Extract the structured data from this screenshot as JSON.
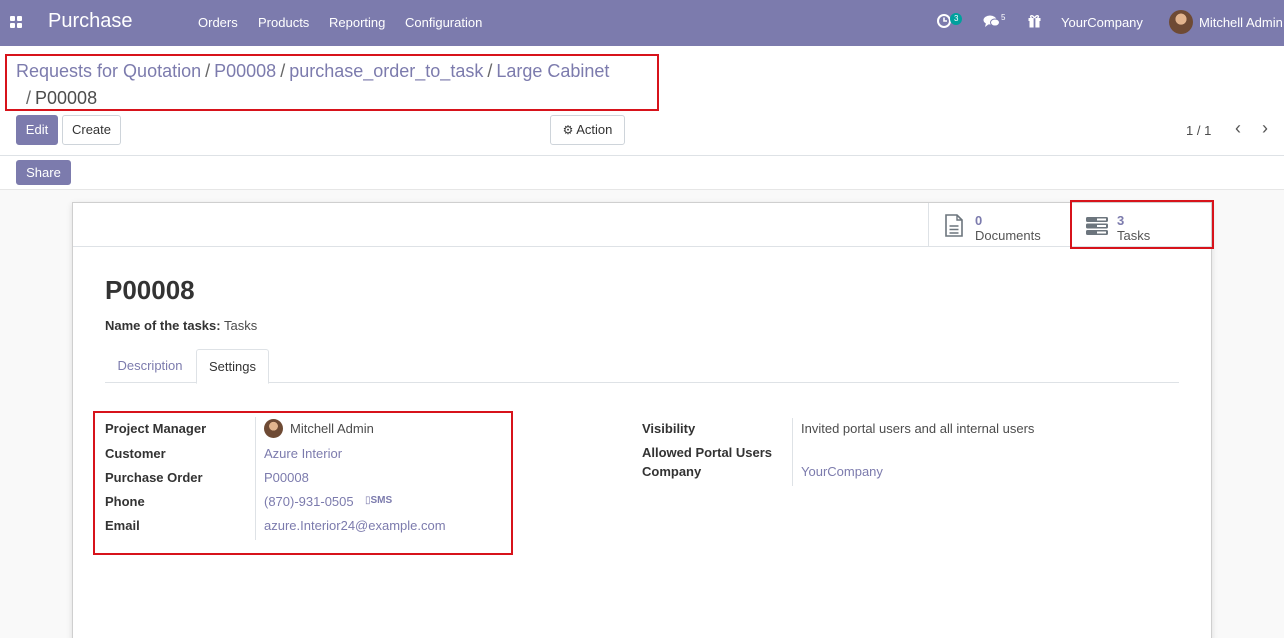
{
  "navbar": {
    "app_title": "Purchase",
    "menu": [
      "Orders",
      "Products",
      "Reporting",
      "Configuration"
    ],
    "activity_count": "3",
    "message_count": "5",
    "company": "YourCompany",
    "user": "Mitchell Admin"
  },
  "breadcrumb": {
    "items": [
      "Requests for Quotation",
      "P00008",
      "purchase_order_to_task",
      "Large Cabinet"
    ],
    "current": "P00008",
    "separator": "/"
  },
  "toolbar": {
    "edit_label": "Edit",
    "create_label": "Create",
    "action_label": "Action",
    "share_label": "Share"
  },
  "pager": {
    "value": "1 / 1"
  },
  "stat_buttons": {
    "documents": {
      "value": "0",
      "label": "Documents"
    },
    "tasks": {
      "value": "3",
      "label": "Tasks"
    }
  },
  "record": {
    "title": "P00008",
    "tasks_name_label": "Name of the tasks:",
    "tasks_name_value": "Tasks"
  },
  "tabs": [
    "Description",
    "Settings"
  ],
  "left_fields": {
    "project_manager_label": "Project Manager",
    "project_manager_value": "Mitchell Admin",
    "customer_label": "Customer",
    "customer_value": "Azure Interior",
    "purchase_order_label": "Purchase Order",
    "purchase_order_value": "P00008",
    "phone_label": "Phone",
    "phone_value": "(870)-931-0505",
    "sms_label": "SMS",
    "email_label": "Email",
    "email_value": "azure.Interior24@example.com"
  },
  "right_fields": {
    "visibility_label": "Visibility",
    "visibility_value": "Invited portal users and all internal users",
    "allowed_portal_users_label": "Allowed Portal Users",
    "company_label": "Company",
    "company_value": "YourCompany"
  },
  "colors": {
    "brand": "#7c7bad",
    "annotation": "#d7131b",
    "activity_badge": "#00a09d"
  },
  "icons": [
    "apps-icon",
    "activity-icon",
    "chat-icon",
    "gift-icon",
    "gear-icon",
    "document-icon",
    "tasks-icon",
    "mobile-icon",
    "chevron-left-icon",
    "chevron-right-icon"
  ]
}
